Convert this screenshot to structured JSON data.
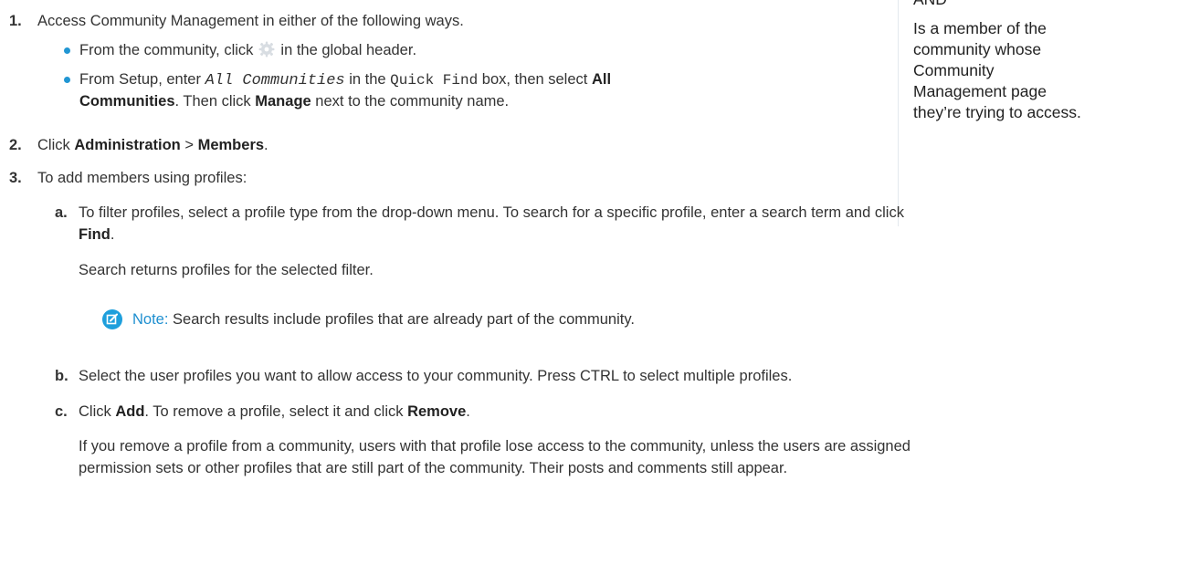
{
  "sidebar": {
    "and_label": "AND",
    "lines": [
      "Is a member of the",
      "community whose",
      "Community",
      "Management page",
      "they’re trying to access."
    ]
  },
  "steps": {
    "s1": {
      "num": "1.",
      "text": "Access Community Management in either of the following ways.",
      "b1": {
        "pre": "From the community, click",
        "icon": "gear-icon",
        "post": "in the global header."
      },
      "b2": {
        "p1": "From Setup, enter",
        "code1": "All Communities",
        "p2": "in the",
        "code2": "Quick Find",
        "p3": "box, then select",
        "bold1a": "All",
        "bold1b": "Communities",
        "p4": ". Then click",
        "bold2": "Manage",
        "p5": "next to the community name."
      }
    },
    "s2": {
      "num": "2.",
      "pre": "Click",
      "bold1": "Administration",
      "sep": ">",
      "bold2": "Members",
      "post": "."
    },
    "s3": {
      "num": "3.",
      "text": "To add members using profiles:",
      "a": {
        "num": "a.",
        "text": "To filter profiles, select a profile type from the drop-down menu. To search for a specific profile, enter a search term and click",
        "bold": "Find",
        "post": ".",
        "sub": "Search returns profiles for the selected filter.",
        "note_label": "Note:",
        "note_text": "Search results include profiles that are already part of the community."
      },
      "b": {
        "num": "b.",
        "text": "Select the user profiles you want to allow access to your community. Press CTRL to select multiple profiles."
      },
      "c": {
        "num": "c.",
        "pre": "Click",
        "bold1": "Add",
        "mid": ". To remove a profile, select it and click",
        "bold2": "Remove",
        "post": ".",
        "para1": "If you remove a profile from a community, users with that profile lose access to the community, unless the users are assigned",
        "para2": "permission sets or other profiles that are still part of the community. Their posts and comments still appear."
      }
    }
  },
  "colors": {
    "accent": "#1e9fdc",
    "text": "#333333"
  }
}
